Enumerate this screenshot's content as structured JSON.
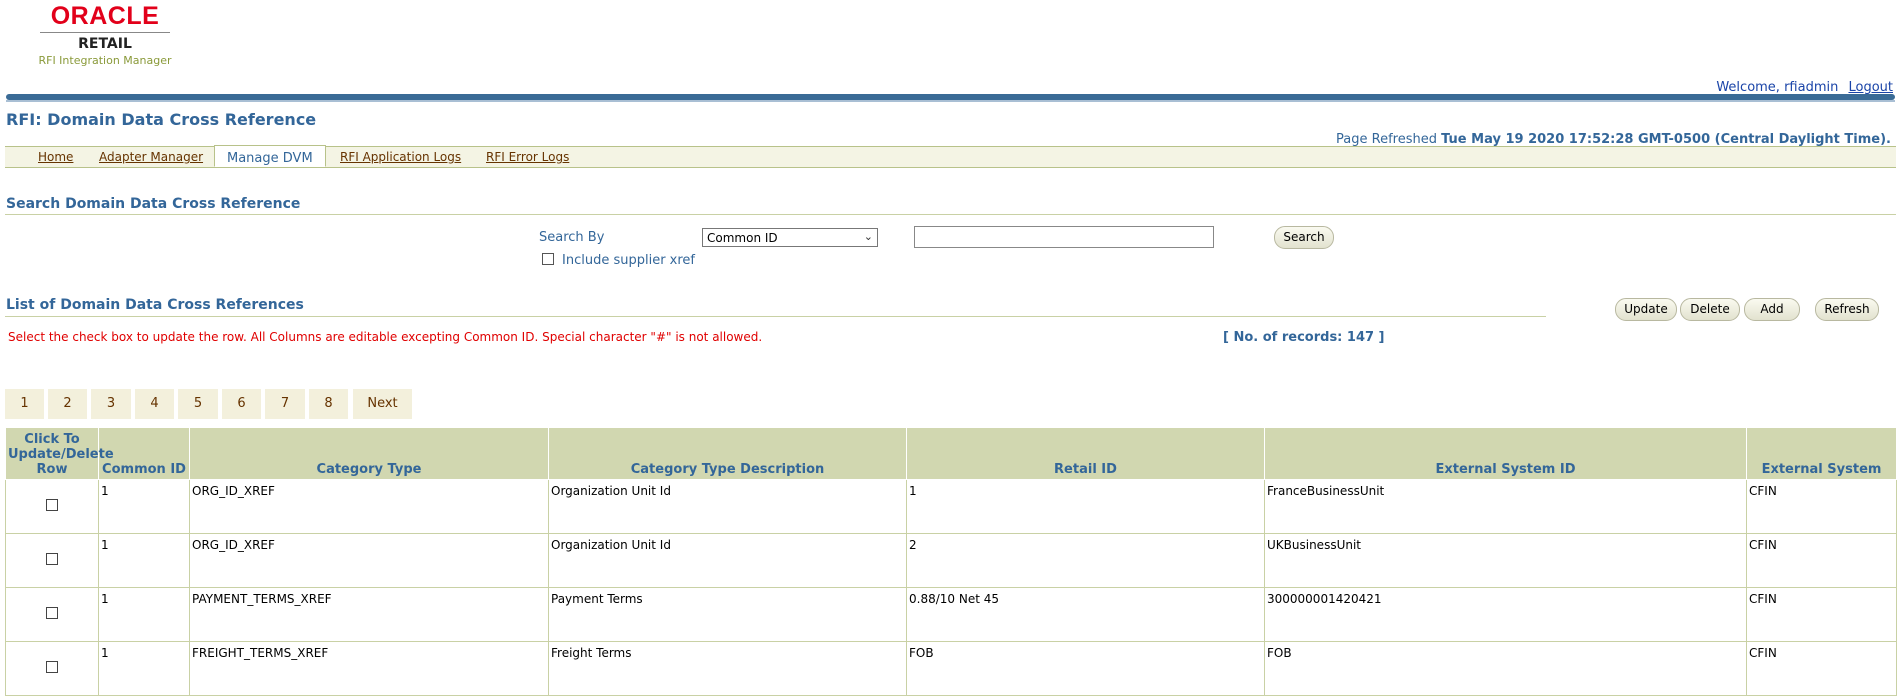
{
  "header": {
    "logo_oracle": "ORACLE",
    "logo_retail": "RETAIL",
    "logo_product": "RFI Integration Manager",
    "welcome": "Welcome, rfiadmin",
    "logout": "Logout"
  },
  "page": {
    "title": "RFI: Domain Data Cross Reference",
    "refreshed_label": "Page Refreshed",
    "refreshed_value": "Tue May 19 2020 17:52:28 GMT-0500 (Central Daylight Time)."
  },
  "tabs": [
    {
      "label": "Home",
      "active": false
    },
    {
      "label": "Adapter Manager",
      "active": false
    },
    {
      "label": "Manage DVM",
      "active": true
    },
    {
      "label": "RFI Application Logs",
      "active": false
    },
    {
      "label": "RFI Error Logs",
      "active": false
    }
  ],
  "search": {
    "header": "Search Domain Data Cross Reference",
    "search_by_label": "Search By",
    "search_by_value": "Common ID",
    "search_text": "",
    "search_button": "Search",
    "include_supplier_label": "Include supplier xref",
    "include_supplier_checked": false
  },
  "list": {
    "header": "List of Domain Data Cross References",
    "instruction": "Select the check box to update the row. All Columns are editable excepting Common ID. Special character \"#\" is not allowed.",
    "record_count": "[ No. of records: 147 ]",
    "buttons": {
      "update": "Update",
      "delete": "Delete",
      "add": "Add",
      "refresh": "Refresh"
    }
  },
  "pagination": [
    "1",
    "2",
    "3",
    "4",
    "5",
    "6",
    "7",
    "8",
    "Next"
  ],
  "table": {
    "columns": [
      "Click To Update/Delete Row",
      "Common ID",
      "Category Type",
      "Category Type Description",
      "Retail ID",
      "External System ID",
      "External System"
    ],
    "rows": [
      {
        "common_id": "1",
        "category_type": "ORG_ID_XREF",
        "description": "Organization Unit Id",
        "retail_id": "1",
        "external_system_id": "FranceBusinessUnit",
        "external_system": "CFIN"
      },
      {
        "common_id": "1",
        "category_type": "ORG_ID_XREF",
        "description": "Organization Unit Id",
        "retail_id": "2",
        "external_system_id": "UKBusinessUnit",
        "external_system": "CFIN"
      },
      {
        "common_id": "1",
        "category_type": "PAYMENT_TERMS_XREF",
        "description": "Payment Terms",
        "retail_id": "0.88/10 Net 45",
        "external_system_id": "300000001420421",
        "external_system": "CFIN"
      },
      {
        "common_id": "1",
        "category_type": "FREIGHT_TERMS_XREF",
        "description": "Freight Terms",
        "retail_id": "FOB",
        "external_system_id": "FOB",
        "external_system": "CFIN"
      }
    ]
  }
}
